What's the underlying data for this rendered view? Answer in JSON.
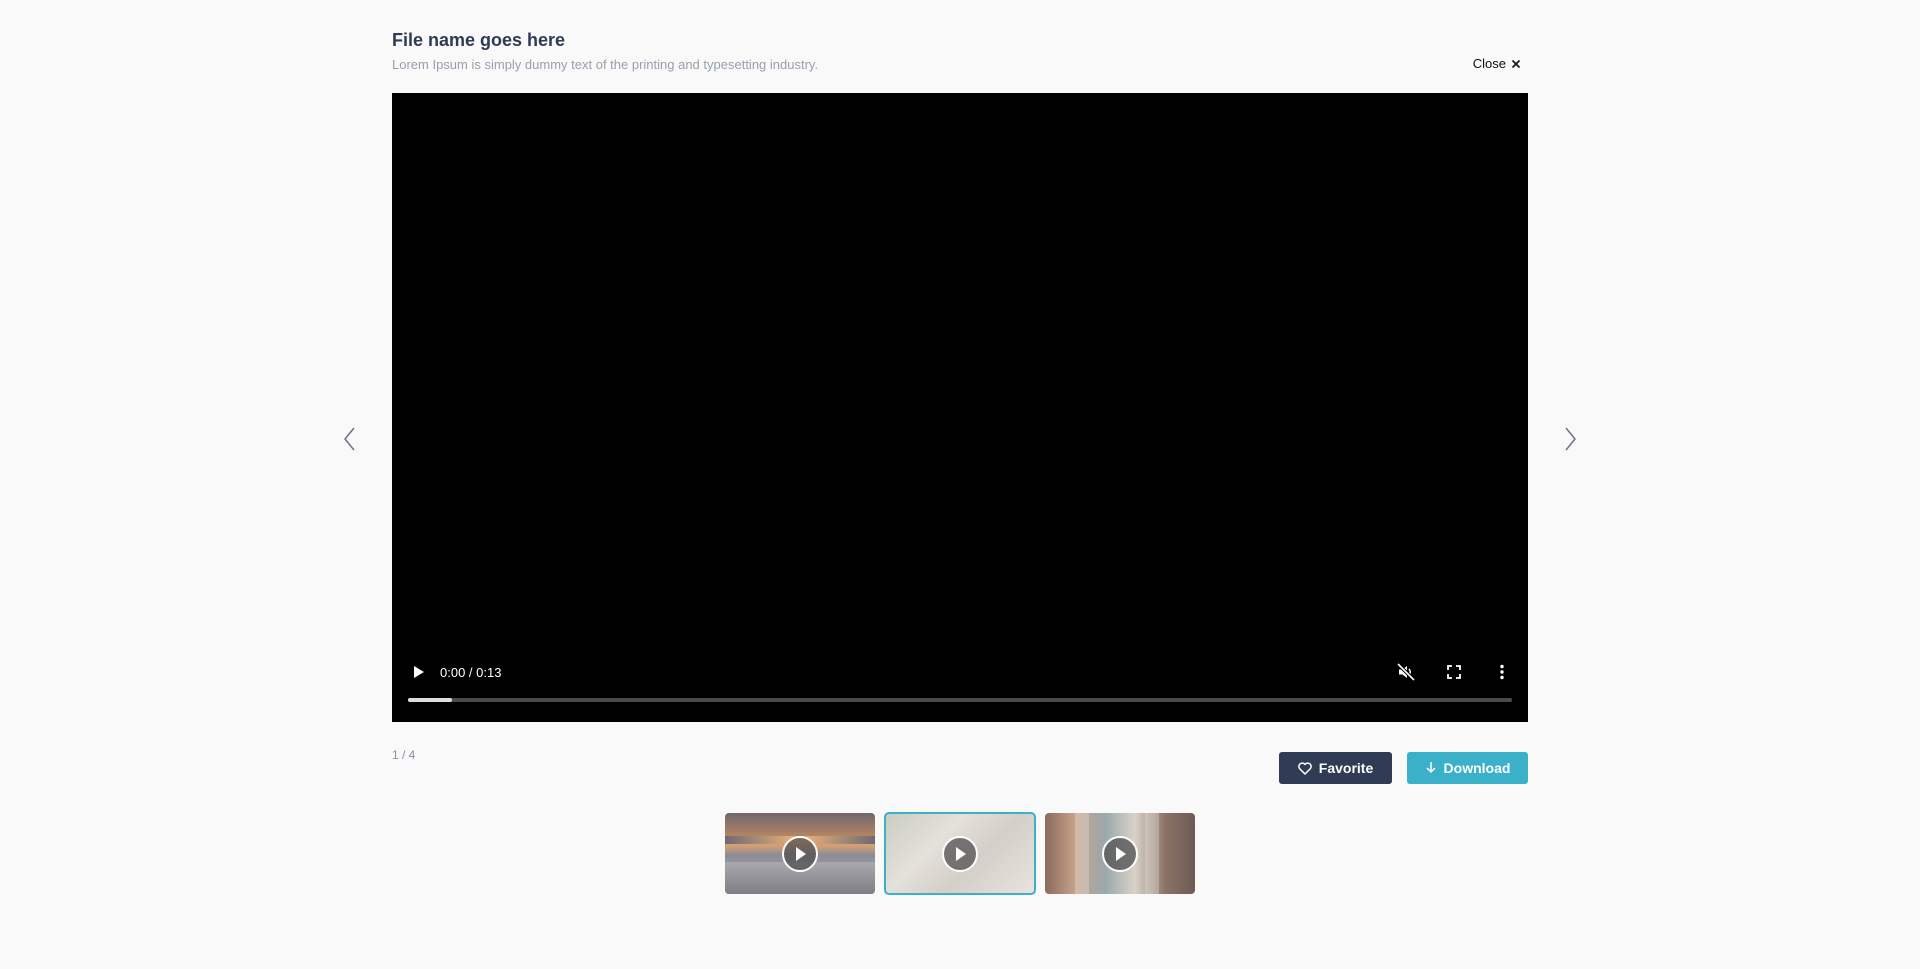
{
  "header": {
    "title": "File name goes here",
    "subtitle": "Lorem Ipsum is simply dummy text of the printing and typesetting industry.",
    "close_label": "Close"
  },
  "player": {
    "time": "0:00 / 0:13",
    "progress_fraction": 0.04
  },
  "counter": "1 / 4",
  "actions": {
    "favorite_label": "Favorite",
    "download_label": "Download"
  },
  "thumbnails": [
    {
      "name": "thumbnail-1",
      "active": false
    },
    {
      "name": "thumbnail-2",
      "active": true
    },
    {
      "name": "thumbnail-3",
      "active": false
    }
  ],
  "colors": {
    "title": "#2f3b55",
    "favorite_bg": "#303b56",
    "download_bg": "#3bb0c9",
    "active_thumb_border": "#3bb0c9"
  }
}
